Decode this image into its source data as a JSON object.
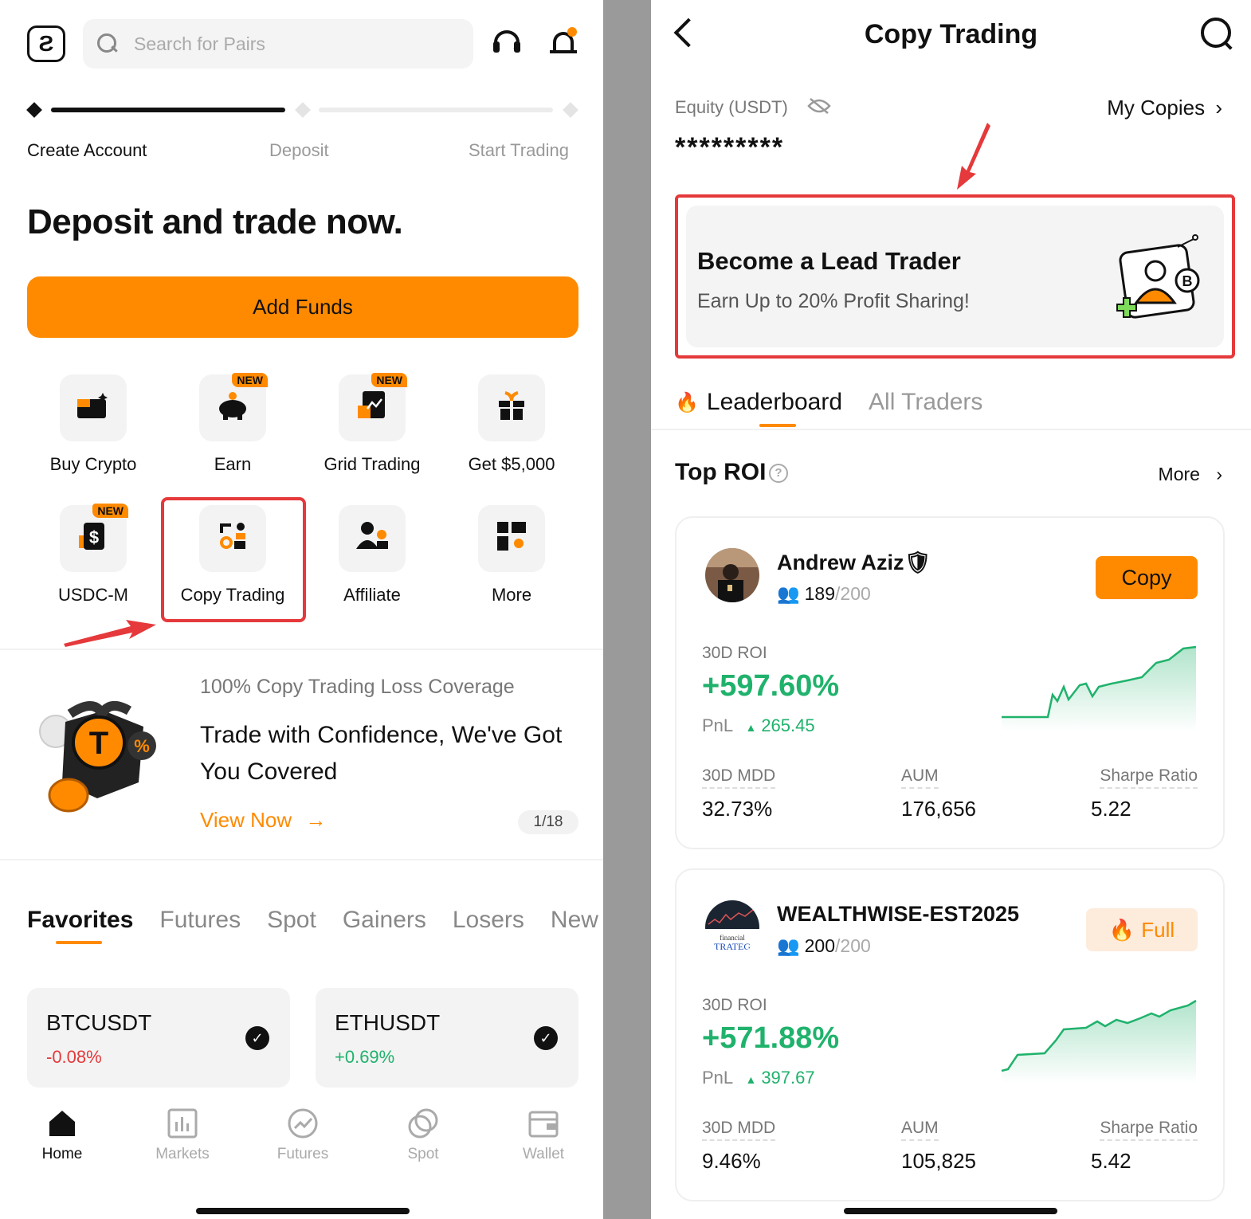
{
  "left": {
    "search_placeholder": "Search for Pairs",
    "steps": [
      "Create Account",
      "Deposit",
      "Start Trading"
    ],
    "headline": "Deposit and trade now.",
    "add_funds": "Add Funds",
    "tiles": [
      {
        "label": "Buy Crypto",
        "icon": "wallet-icon",
        "new": ""
      },
      {
        "label": "Earn",
        "icon": "piggy-bank-icon",
        "new": "NEW"
      },
      {
        "label": "Grid Trading",
        "icon": "grid-chart-icon",
        "new": "NEW"
      },
      {
        "label": "Get $5,000",
        "icon": "gift-icon",
        "new": ""
      },
      {
        "label": "USDC-M",
        "icon": "dollar-doc-icon",
        "new": "NEW"
      },
      {
        "label": "Copy Trading",
        "icon": "copy-trading-icon",
        "new": ""
      },
      {
        "label": "Affiliate",
        "icon": "people-icon",
        "new": ""
      },
      {
        "label": "More",
        "icon": "grid-more-icon",
        "new": ""
      }
    ],
    "promo": {
      "title": "100% Copy Trading Loss Coverage",
      "text": "Trade with Confidence, We've Got You Covered",
      "cta": "View Now",
      "pager": "1/18"
    },
    "market_tabs": [
      "Favorites",
      "Futures",
      "Spot",
      "Gainers",
      "Losers",
      "New"
    ],
    "favorites": [
      {
        "symbol": "BTCUSDT",
        "change": "-0.08%",
        "color": "#e5393b"
      },
      {
        "symbol": "ETHUSDT",
        "change": "+0.69%",
        "color": "#20b26c"
      }
    ],
    "nav": [
      "Home",
      "Markets",
      "Futures",
      "Spot",
      "Wallet"
    ]
  },
  "right": {
    "title": "Copy Trading",
    "equity_label": "Equity (USDT)",
    "equity_value": "*********",
    "my_copies": "My Copies",
    "lead": {
      "title": "Become a Lead Trader",
      "subtitle": "Earn Up to 20% Profit Sharing!"
    },
    "tabs": [
      "Leaderboard",
      "All Traders"
    ],
    "section_title": "Top ROI",
    "more": "More",
    "roi_label": "30D ROI",
    "pnl_label": "PnL",
    "stat_labels": [
      "30D MDD",
      "AUM",
      "Sharpe Ratio"
    ],
    "traders": [
      {
        "name": "Andrew Aziz🛡",
        "count": "189",
        "max": "/200",
        "button": "Copy",
        "roi": "+597.60%",
        "pnl": "265.45",
        "mdd": "32.73%",
        "aum": "176,656",
        "sharpe": "5.22"
      },
      {
        "name": "WEALTHWISE-EST2025",
        "count": "200",
        "max": "/200",
        "button": "Full",
        "roi": "+571.88%",
        "pnl": "397.67",
        "mdd": "9.46%",
        "aum": "105,825",
        "sharpe": "5.42"
      }
    ]
  },
  "colors": {
    "accent": "#ff8a00",
    "up": "#20b26c",
    "down": "#e5393b",
    "highlight": "#e5393b"
  }
}
